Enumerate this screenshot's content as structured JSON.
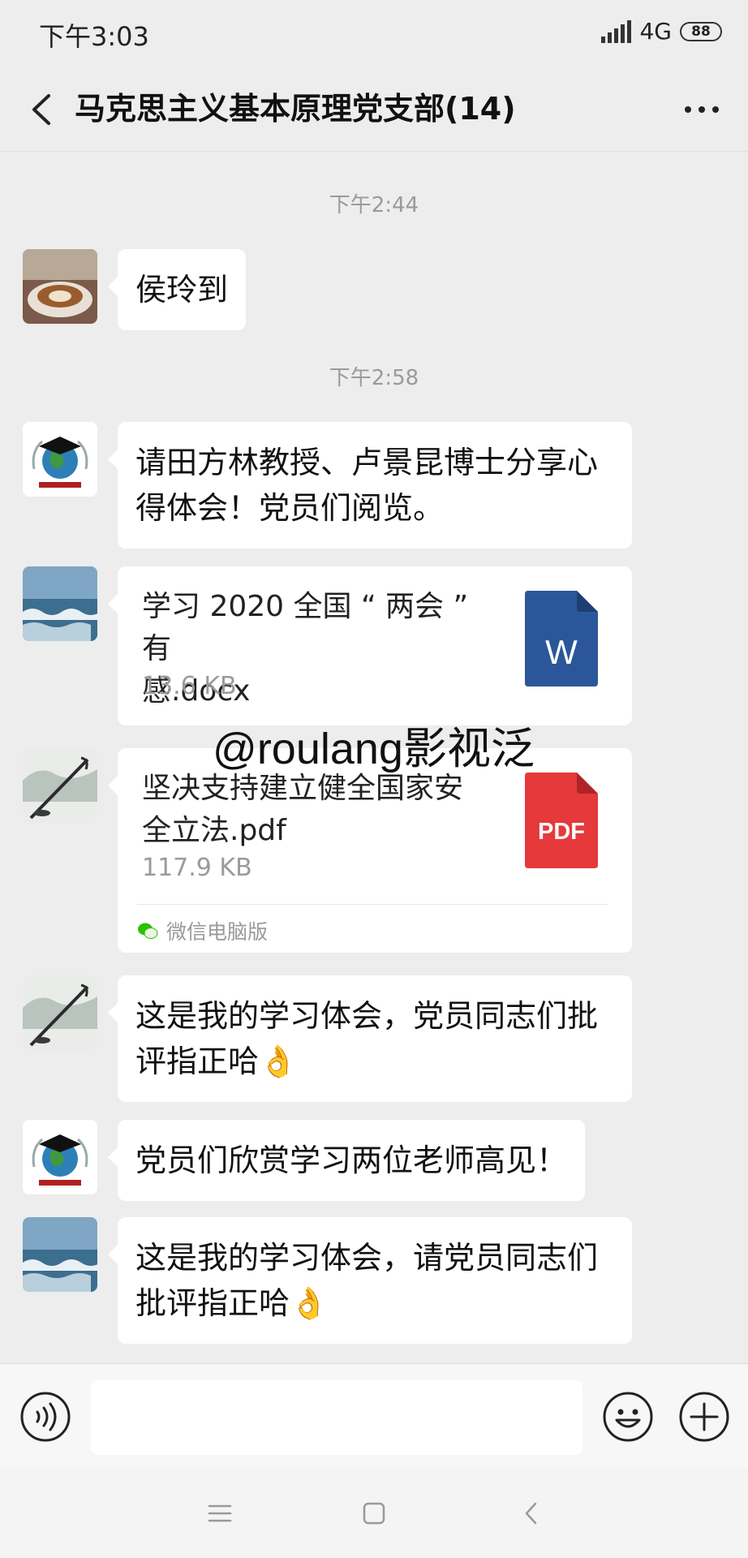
{
  "status_bar": {
    "time": "下午3:03",
    "network": "4G",
    "battery": "88"
  },
  "header": {
    "title": "马克思主义基本原理党支部(14)"
  },
  "timestamps": [
    "下午2:44",
    "下午2:58"
  ],
  "messages": [
    {
      "type": "text",
      "avatar": "coffee-avatar",
      "text": "侯玲到"
    },
    {
      "type": "text",
      "avatar": "university-globe-avatar",
      "lines": [
        "请田方林教授、卢景昆博士分享心",
        "得体会！党员们阅览。"
      ]
    },
    {
      "type": "file",
      "avatar": "ocean-waves-avatar",
      "file_lines": [
        "学习 2020 全国 “ 两会 ” 有",
        "感.docx"
      ],
      "size": "13.6 KB",
      "icon": "word-doc-icon",
      "icon_label": "W",
      "icon_color": "#2b579a"
    },
    {
      "type": "file",
      "avatar": "ink-painting-avatar",
      "file_lines": [
        "坚决支持建立健全国家安",
        "全立法.pdf"
      ],
      "size": "117.9 KB",
      "icon": "pdf-icon",
      "icon_label": "PDF",
      "icon_color": "#e5393b",
      "source": "微信电脑版"
    },
    {
      "type": "text",
      "avatar": "ink-painting-avatar",
      "lines": [
        "这是我的学习体会，党员同志们批",
        "评指正哈👌"
      ]
    },
    {
      "type": "text",
      "avatar": "university-globe-avatar",
      "text": "党员们欣赏学习两位老师高见！"
    },
    {
      "type": "text",
      "avatar": "ocean-waves-avatar",
      "lines": [
        "这是我的学习体会，请党员同志们",
        "批评指正哈👌"
      ]
    }
  ],
  "watermark": "@roulang影视泛",
  "colors": {
    "background": "#ededed",
    "bubble": "#ffffff",
    "word": "#2b579a",
    "pdf": "#e5393b"
  }
}
